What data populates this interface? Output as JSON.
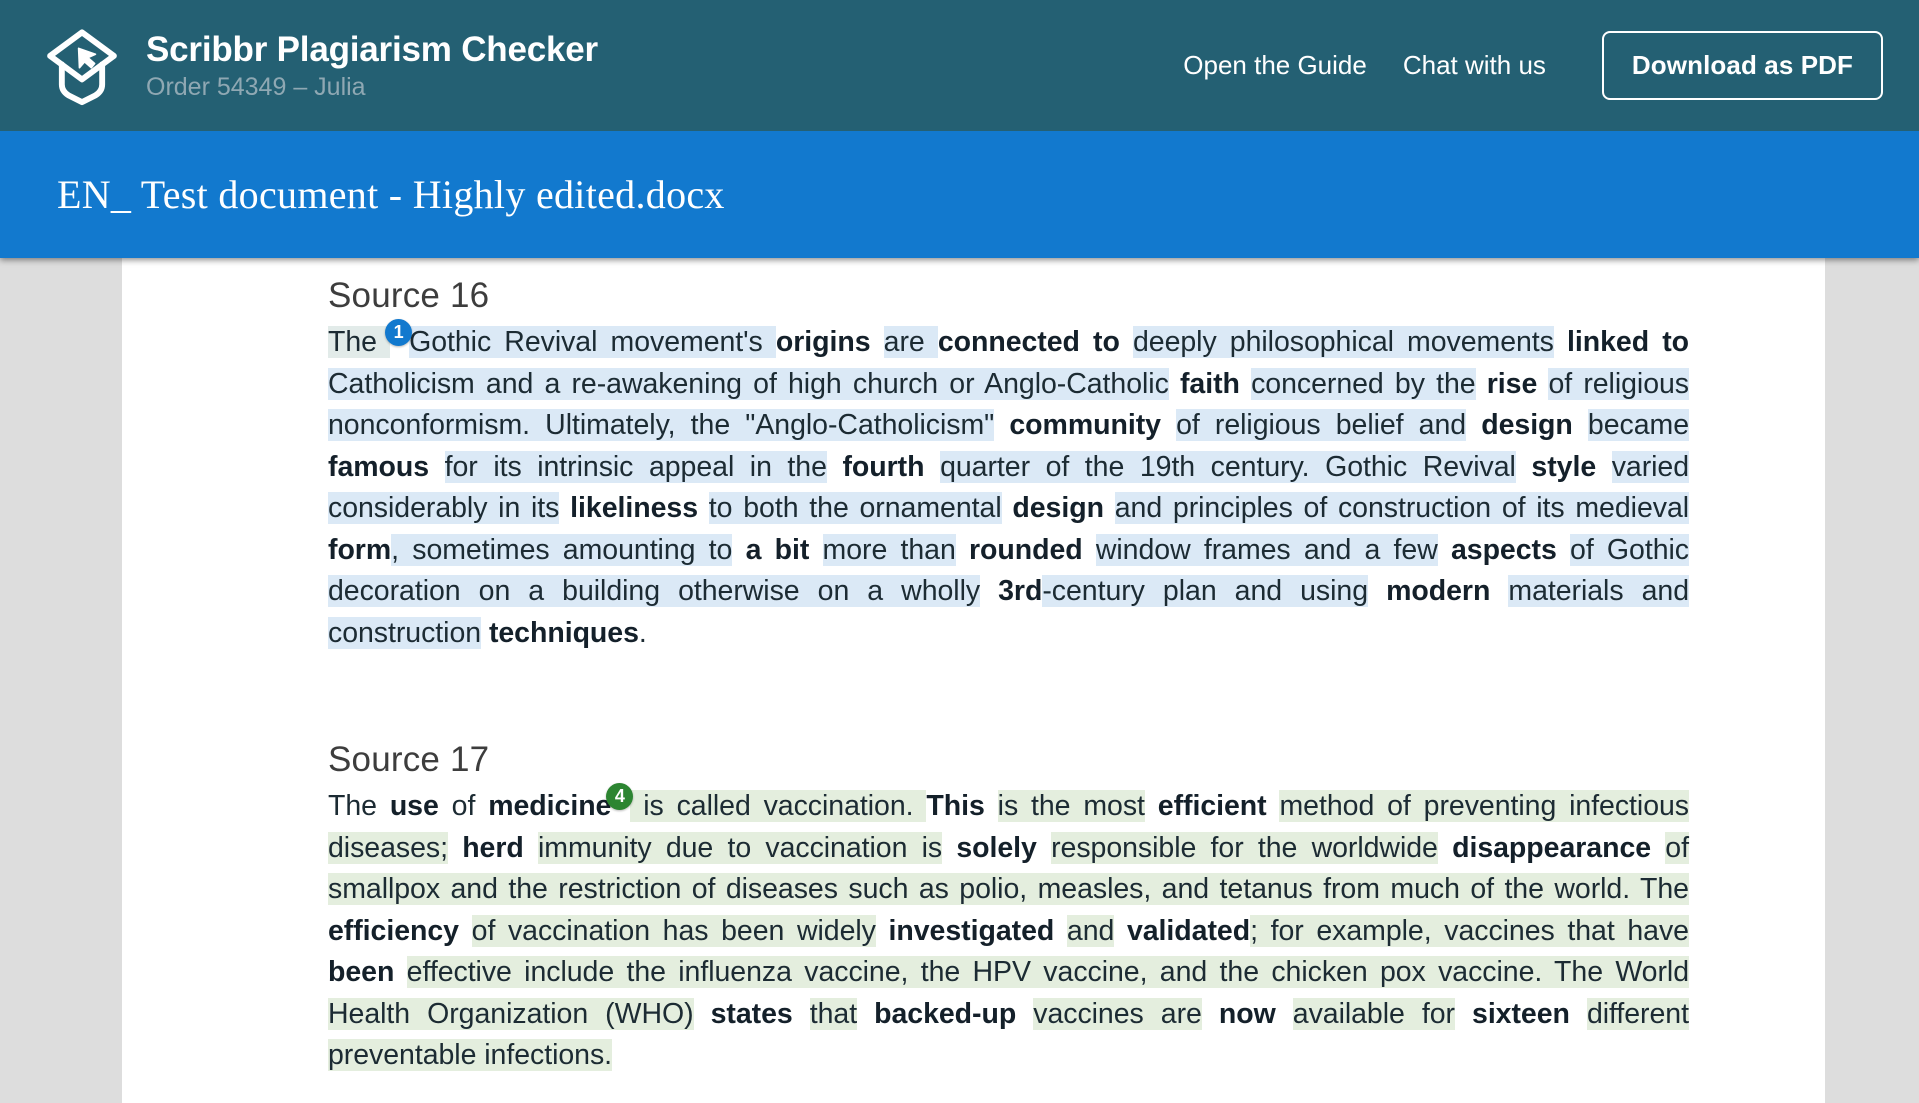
{
  "header": {
    "logo_icon": "graduation-cap-cursor-logo",
    "title": "Scribbr Plagiarism Checker",
    "subtitle": "Order 54349 – Julia",
    "nav": [
      {
        "label": "Open the Guide",
        "name": "open-the-guide"
      },
      {
        "label": "Chat with us",
        "name": "chat-with-us"
      }
    ],
    "download_button": "Download as PDF",
    "bg_color": "#246073",
    "text_color": "#ffffff",
    "subtitle_color": "#8fa8b3"
  },
  "doc_bar": {
    "filename": "EN_ Test document - Highly edited.docx",
    "bg_color": "#1279ce"
  },
  "colors": {
    "page_bg": "#dddddd",
    "paper_bg": "#ffffff",
    "highlight_blue": "#dbe9f6",
    "highlight_green": "#e4eede",
    "badge_blue": "#1279ce",
    "badge_green": "#2c8531"
  },
  "sources": [
    {
      "heading": "Source 16",
      "badge": "1",
      "badge_color": "blue",
      "highlight_color": "blue",
      "text": "The Gothic Revival movement's origins are connected to deeply philosophical movements linked to Catholicism and a re-awakening of high church or Anglo-Catholic faith concerned by the rise of religious nonconformism. Ultimately, the \"Anglo-Catholicism\" community of religious belief and design became famous for its intrinsic appeal in the fourth quarter of the 19th century. Gothic Revival style varied considerably in its likeliness to both the ornamental design and principles of construction of its medieval form, sometimes amounting to a bit more than rounded window frames and a few aspects of Gothic decoration on a building otherwise on a wholly 3rd-century plan and using modern materials and construction techniques.",
      "bold_words": [
        "origins",
        "connected to",
        "linked to",
        "faith",
        "rise",
        "community",
        "design",
        "famous",
        "fourth",
        "style",
        "likeliness",
        "design",
        "form",
        "a bit",
        "rounded",
        "aspects",
        "3rd",
        "modern",
        "techniques"
      ]
    },
    {
      "heading": "Source 17",
      "badge": "4",
      "badge_color": "green",
      "highlight_color": "green",
      "text": "The use of medicine is called vaccination. This is the most efficient method of preventing infectious diseases; herd immunity due to vaccination is solely responsible for the worldwide disappearance of smallpox and the restriction of diseases such as polio, measles, and tetanus from much of the world. The efficiency of vaccination has been widely investigated and validated; for example, vaccines that have been effective include the influenza vaccine, the HPV vaccine, and the chicken pox vaccine. The World Health Organization (WHO) states that backed-up vaccines are now available for sixteen different preventable infections.",
      "bold_words": [
        "use",
        "medicine",
        "This",
        "efficient",
        "herd",
        "solely",
        "disappearance",
        "efficiency",
        "investigated",
        "validated",
        "been",
        "states",
        "backed-up",
        "now",
        "sixteen"
      ]
    }
  ]
}
